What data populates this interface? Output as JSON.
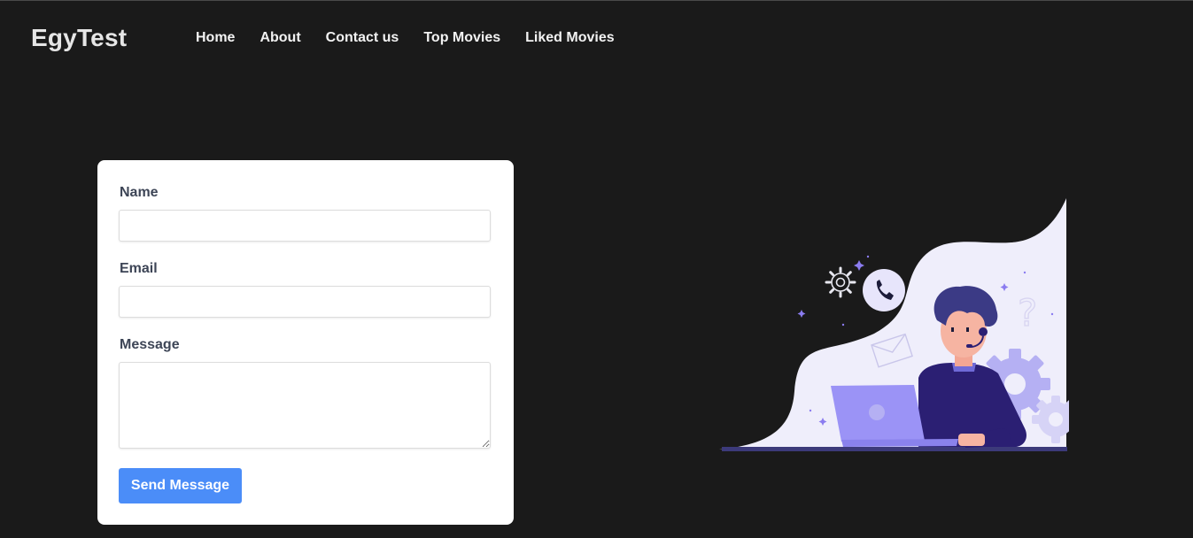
{
  "nav": {
    "brand": "EgyTest",
    "links": [
      {
        "label": "Home"
      },
      {
        "label": "About"
      },
      {
        "label": "Contact us"
      },
      {
        "label": "Top Movies"
      },
      {
        "label": "Liked Movies"
      }
    ]
  },
  "form": {
    "name_label": "Name",
    "name_value": "",
    "email_label": "Email",
    "email_value": "",
    "message_label": "Message",
    "message_value": "",
    "submit_label": "Send Message"
  },
  "illustration": {
    "icons": [
      "gear-icon",
      "phone-icon",
      "envelope-icon",
      "question-icon",
      "headset-icon",
      "laptop-icon"
    ]
  },
  "colors": {
    "page_background": "#1a1a1a",
    "card_background": "#ffffff",
    "button": "#4b8df8",
    "label": "#3d4556",
    "accent_purple": "#9b93f6",
    "shirt": "#2b1f73"
  }
}
